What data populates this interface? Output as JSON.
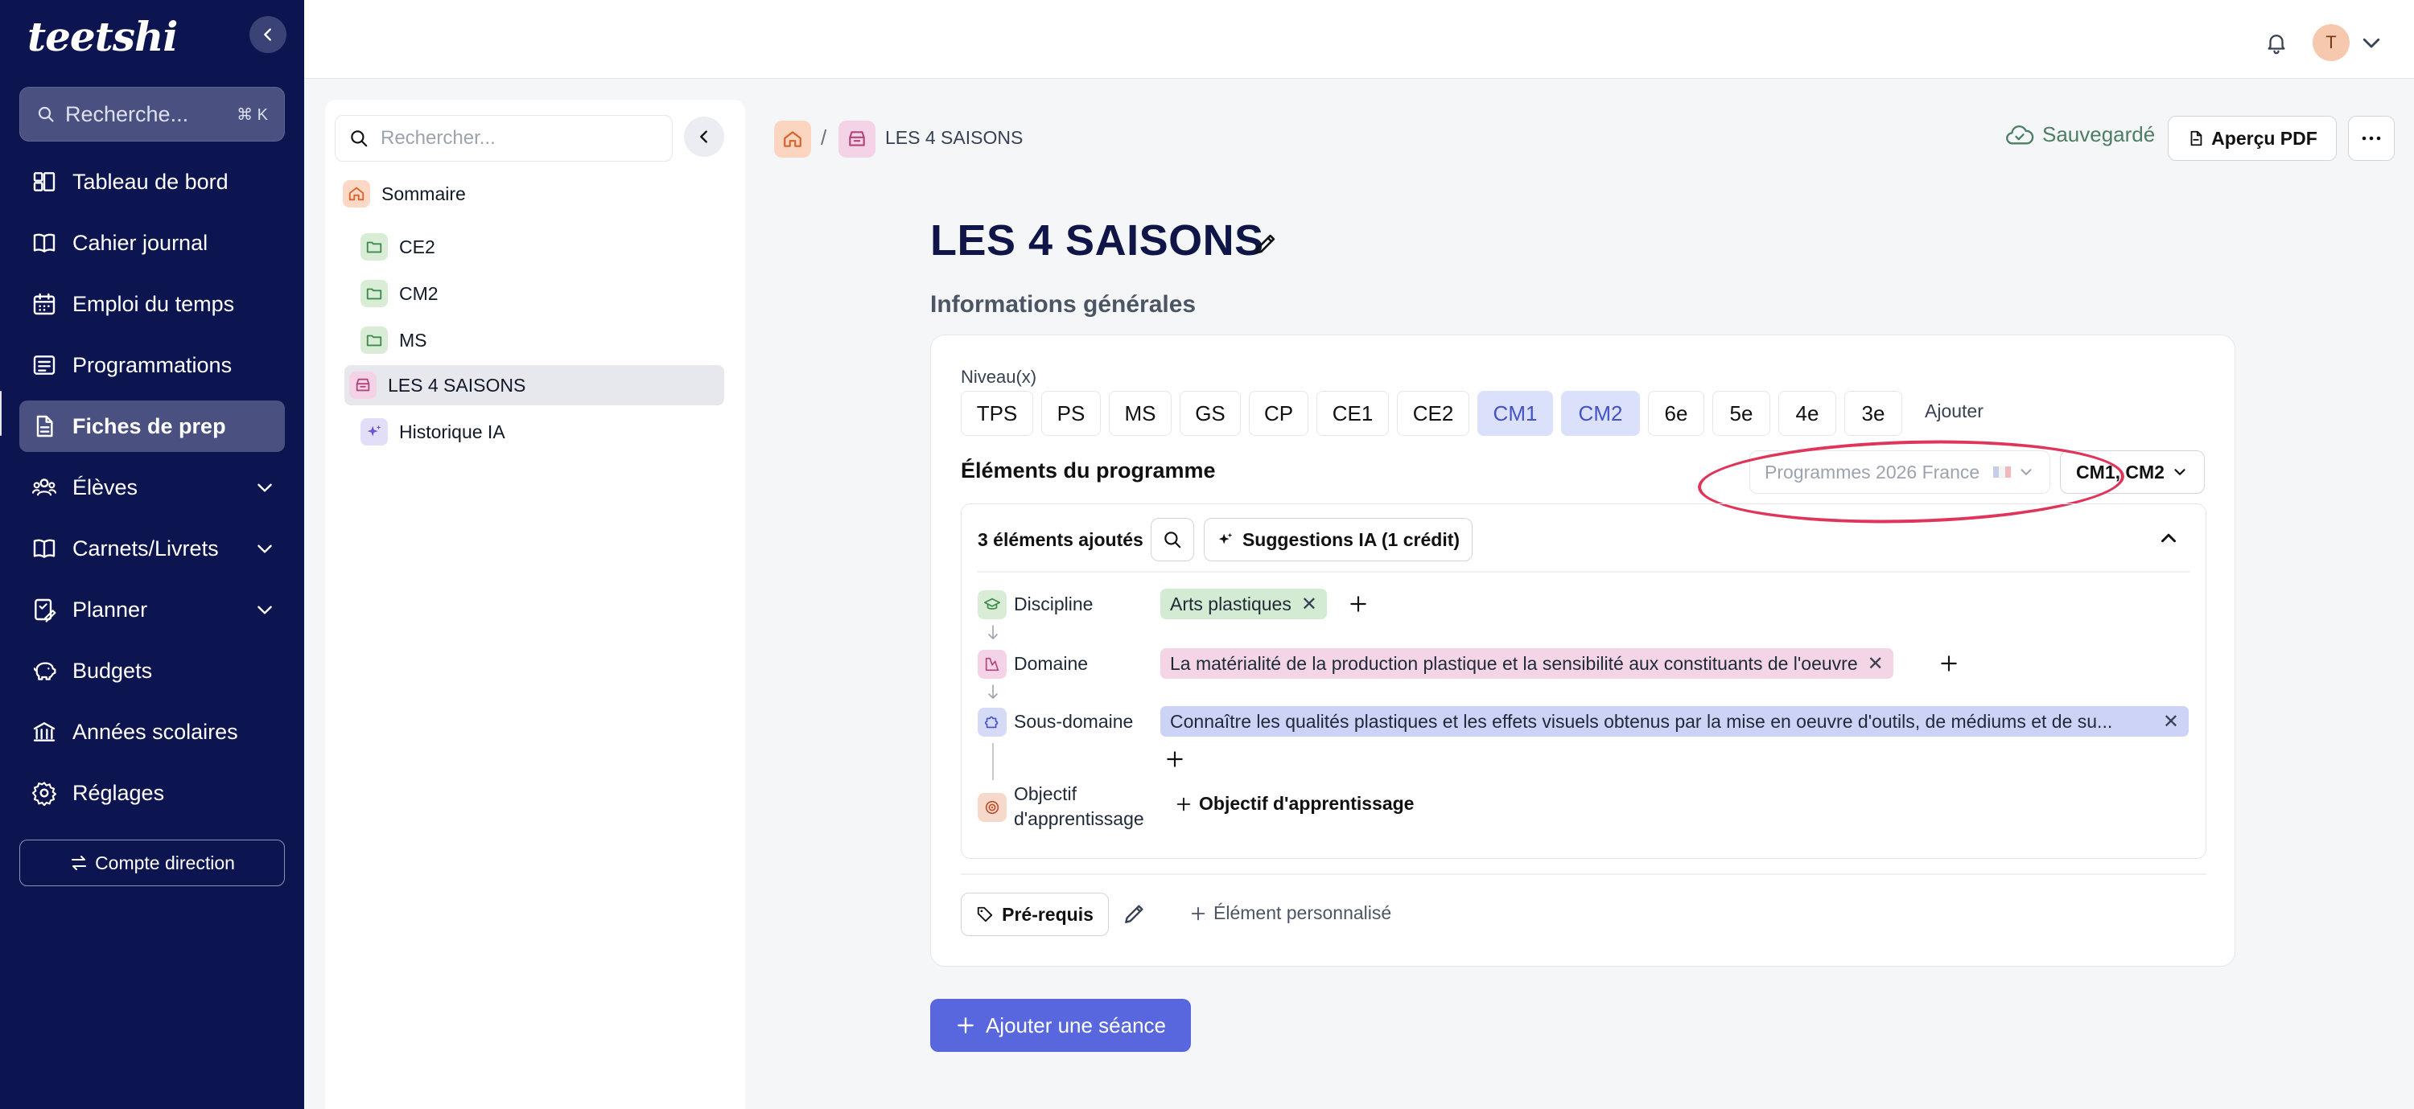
{
  "app": {
    "logo": "teetshi"
  },
  "sidebar": {
    "search_placeholder": "Recherche...",
    "search_shortcut": "⌘ K",
    "items": [
      {
        "label": "Tableau de bord",
        "icon": "dashboard-icon"
      },
      {
        "label": "Cahier journal",
        "icon": "book-icon"
      },
      {
        "label": "Emploi du temps",
        "icon": "calendar-icon"
      },
      {
        "label": "Programmations",
        "icon": "list-icon"
      },
      {
        "label": "Fiches de prep",
        "icon": "file-icon",
        "active": true
      },
      {
        "label": "Élèves",
        "icon": "students-icon",
        "expandable": true
      },
      {
        "label": "Carnets/Livrets",
        "icon": "notebook-icon",
        "expandable": true
      },
      {
        "label": "Planner",
        "icon": "planner-icon",
        "expandable": true
      },
      {
        "label": "Budgets",
        "icon": "piggy-bank-icon"
      },
      {
        "label": "Années scolaires",
        "icon": "school-icon"
      },
      {
        "label": "Réglages",
        "icon": "gear-icon"
      }
    ],
    "direction_button": "Compte direction"
  },
  "header": {
    "avatar_initial": "T"
  },
  "tree": {
    "search_placeholder": "Rechercher...",
    "sommaire": "Sommaire",
    "items": [
      {
        "label": "CE2",
        "icon": "folder-icon"
      },
      {
        "label": "CM2",
        "icon": "folder-icon"
      },
      {
        "label": "MS",
        "icon": "folder-icon"
      },
      {
        "label": "LES 4 SAISONS",
        "icon": "box-icon",
        "active": true
      },
      {
        "label": "Historique IA",
        "icon": "sparkles-icon"
      }
    ]
  },
  "breadcrumb": {
    "sep": "/",
    "current": "LES 4 SAISONS"
  },
  "toolbar": {
    "saved": "Sauvegardé",
    "pdf": "Aperçu PDF"
  },
  "page": {
    "title": "LES 4 SAISONS",
    "section": "Informations générales",
    "niveaux_label": "Niveau(x)",
    "levels": [
      {
        "label": "TPS",
        "selected": false
      },
      {
        "label": "PS",
        "selected": false
      },
      {
        "label": "MS",
        "selected": false
      },
      {
        "label": "GS",
        "selected": false
      },
      {
        "label": "CP",
        "selected": false
      },
      {
        "label": "CE1",
        "selected": false
      },
      {
        "label": "CE2",
        "selected": false
      },
      {
        "label": "CM1",
        "selected": true
      },
      {
        "label": "CM2",
        "selected": true
      },
      {
        "label": "6e",
        "selected": false
      },
      {
        "label": "5e",
        "selected": false
      },
      {
        "label": "4e",
        "selected": false
      },
      {
        "label": "3e",
        "selected": false
      }
    ],
    "add_level": "Ajouter",
    "elements_title": "Éléments du programme",
    "program_select": "Programmes 2026 France",
    "levels_select": "CM1, CM2",
    "count": "3 éléments ajoutés",
    "suggestions": "Suggestions IA (1 crédit)",
    "rows": {
      "discipline": {
        "label": "Discipline",
        "tag": "Arts plastiques"
      },
      "domaine": {
        "label": "Domaine",
        "tag": "La matérialité de la production plastique et la sensibilité aux constituants de l'oeuvre"
      },
      "sous_domaine": {
        "label": "Sous-domaine",
        "tag": "Connaître les qualités plastiques et les effets visuels obtenus par la mise en oeuvre d'outils, de médiums et de su..."
      },
      "objectif": {
        "label_1": "Objectif",
        "label_2": "d'apprentissage",
        "add": "Objectif d'apprentissage"
      }
    },
    "prerequis": "Pré-requis",
    "element_perso": "Élément personnalisé",
    "add_seance": "Ajouter une séance"
  },
  "colors": {
    "sidebar_bg": "#0d1550",
    "accent": "#5867dd",
    "selected_level_bg": "#dbe0fb",
    "tag_discipline": "#d4ebd3",
    "tag_domaine": "#f3d5e6",
    "tag_sous_domaine": "#cdd3f7",
    "annotation": "#e0355a"
  }
}
